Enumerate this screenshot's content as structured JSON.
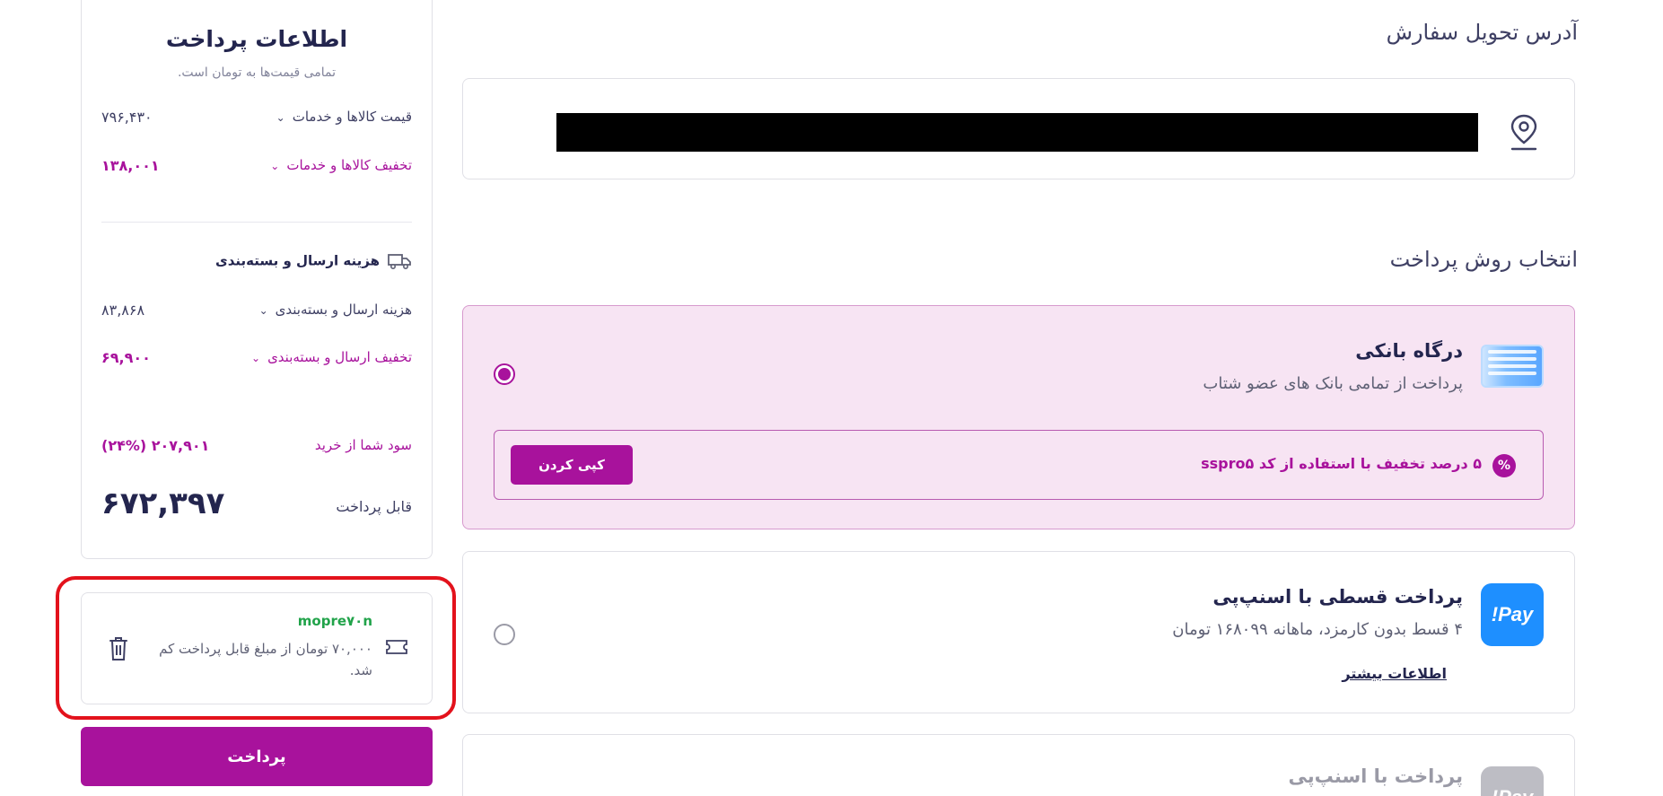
{
  "delivery": {
    "title": "آدرس تحویل سفارش",
    "icon": "location-pin-icon"
  },
  "payment": {
    "title": "انتخاب روش پرداخت",
    "methods": [
      {
        "name": "درگاه بانکی",
        "description": "پرداخت از تمامی بانک های عضو شتاب",
        "selected": true,
        "icon": "bank-card-icon",
        "promo": {
          "text": "۵ درصد تخفیف با استفاده از کد sspro۵",
          "copy_label": "کپی کردن",
          "icon": "percent-badge-icon"
        }
      },
      {
        "name": "پرداخت قسطی با اسنپ‌پی",
        "description": "۴ قسط بدون کارمزد، ماهانه ۱۶۸۰۹۹ تومان",
        "more_link": "اطلاعات بیشتر",
        "selected": false,
        "logo_text": "Pay!"
      },
      {
        "name": "پرداخت با اسنپ‌پی",
        "selected": false,
        "logo_text": "Pay!"
      }
    ]
  },
  "summary": {
    "title": "اطلاعات پرداخت",
    "subtitle": "تمامی قیمت‌ها به تومان است.",
    "items_price": {
      "label": "قیمت کالاها و خدمات",
      "value": "۷۹۶,۴۳۰"
    },
    "items_discount": {
      "label": "تخفیف کالاها و خدمات",
      "value": "۱۳۸,۰۰۱"
    },
    "shipping_header": "هزینه ارسال و بسته‌بندی",
    "shipping_cost": {
      "label": "هزینه ارسال و بسته‌بندی",
      "value": "۸۳,۸۶۸"
    },
    "shipping_discount": {
      "label": "تخفیف ارسال و بسته‌بندی",
      "value": "۶۹,۹۰۰"
    },
    "profit": {
      "label": "سود شما از خرید",
      "value": "(۲۴%) ۲۰۷,۹۰۱"
    },
    "total": {
      "label": "قابل پرداخت",
      "value": "۶۷۲,۳۹۷"
    }
  },
  "voucher": {
    "code": "mopre۷۰n",
    "description": "۷۰,۰۰۰ تومان از مبلغ قابل پرداخت کم شد."
  },
  "pay_button": "پرداخت",
  "colors": {
    "accent": "#a8129c",
    "selected_bg": "#f7e4f3",
    "voucher_code": "#21a34a",
    "highlight": "#e3121c"
  }
}
